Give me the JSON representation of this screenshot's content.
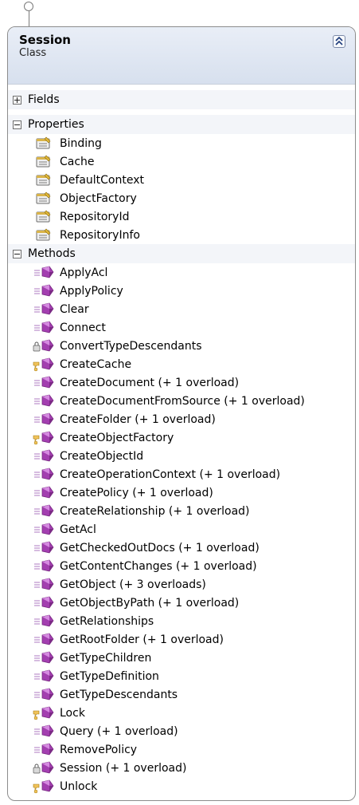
{
  "class": {
    "name": "Session",
    "stereotype": "Class"
  },
  "sections": {
    "fields": {
      "label": "Fields",
      "expanded": false
    },
    "properties": {
      "label": "Properties",
      "expanded": true
    },
    "methods": {
      "label": "Methods",
      "expanded": true
    }
  },
  "properties": [
    "Binding",
    "Cache",
    "DefaultContext",
    "ObjectFactory",
    "RepositoryId",
    "RepositoryInfo"
  ],
  "methods": [
    {
      "label": "ApplyAcl",
      "icon": "public-method-icon"
    },
    {
      "label": "ApplyPolicy",
      "icon": "public-method-icon"
    },
    {
      "label": "Clear",
      "icon": "public-method-icon"
    },
    {
      "label": "Connect",
      "icon": "public-method-icon"
    },
    {
      "label": "ConvertTypeDescendants",
      "icon": "private-method-icon"
    },
    {
      "label": "CreateCache",
      "icon": "protected-method-icon"
    },
    {
      "label": "CreateDocument (+ 1 overload)",
      "icon": "public-method-icon"
    },
    {
      "label": "CreateDocumentFromSource (+ 1 overload)",
      "icon": "public-method-icon"
    },
    {
      "label": "CreateFolder (+ 1 overload)",
      "icon": "public-method-icon"
    },
    {
      "label": "CreateObjectFactory",
      "icon": "protected-method-icon"
    },
    {
      "label": "CreateObjectId",
      "icon": "public-method-icon"
    },
    {
      "label": "CreateOperationContext (+ 1 overload)",
      "icon": "public-method-icon"
    },
    {
      "label": "CreatePolicy (+ 1 overload)",
      "icon": "public-method-icon"
    },
    {
      "label": "CreateRelationship (+ 1 overload)",
      "icon": "public-method-icon"
    },
    {
      "label": "GetAcl",
      "icon": "public-method-icon"
    },
    {
      "label": "GetCheckedOutDocs (+ 1 overload)",
      "icon": "public-method-icon"
    },
    {
      "label": "GetContentChanges (+ 1 overload)",
      "icon": "public-method-icon"
    },
    {
      "label": "GetObject (+ 3 overloads)",
      "icon": "public-method-icon"
    },
    {
      "label": "GetObjectByPath (+ 1 overload)",
      "icon": "public-method-icon"
    },
    {
      "label": "GetRelationships",
      "icon": "public-method-icon"
    },
    {
      "label": "GetRootFolder (+ 1 overload)",
      "icon": "public-method-icon"
    },
    {
      "label": "GetTypeChildren",
      "icon": "public-method-icon"
    },
    {
      "label": "GetTypeDefinition",
      "icon": "public-method-icon"
    },
    {
      "label": "GetTypeDescendants",
      "icon": "public-method-icon"
    },
    {
      "label": "Lock",
      "icon": "protected-method-icon"
    },
    {
      "label": "Query (+ 1 overload)",
      "icon": "public-method-icon"
    },
    {
      "label": "RemovePolicy",
      "icon": "public-method-icon"
    },
    {
      "label": "Session (+ 1 overload)",
      "icon": "private-method-icon"
    },
    {
      "label": "Unlock",
      "icon": "protected-method-icon"
    }
  ]
}
